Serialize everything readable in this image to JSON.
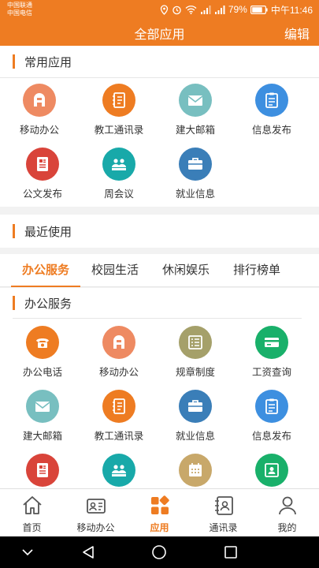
{
  "status_bar": {
    "carrier1": "中国联通",
    "carrier2": "中国电信",
    "battery": "79%",
    "time": "中午11:46"
  },
  "header": {
    "title": "全部应用",
    "edit": "编辑"
  },
  "common": {
    "title": "常用应用",
    "apps": [
      {
        "label": "移动办公",
        "icon": "a-logo-icon",
        "color": "#ee8a62"
      },
      {
        "label": "教工通讯录",
        "icon": "contacts-book-icon",
        "color": "#ee7c22"
      },
      {
        "label": "建大邮箱",
        "icon": "mail-icon",
        "color": "#78bfc0"
      },
      {
        "label": "信息发布",
        "icon": "clipboard-icon",
        "color": "#3d8fe0"
      },
      {
        "label": "公文发布",
        "icon": "document-icon",
        "color": "#d9443a"
      },
      {
        "label": "周会议",
        "icon": "meeting-icon",
        "color": "#18a9a9"
      },
      {
        "label": "就业信息",
        "icon": "briefcase-icon",
        "color": "#3a7eb8"
      }
    ]
  },
  "recent": {
    "title": "最近使用"
  },
  "tabs": [
    {
      "label": "办公服务",
      "active": true
    },
    {
      "label": "校园生活",
      "active": false
    },
    {
      "label": "休闲娱乐",
      "active": false
    },
    {
      "label": "排行榜单",
      "active": false
    }
  ],
  "office": {
    "title": "办公服务",
    "apps": [
      {
        "label": "办公电话",
        "icon": "phone-icon",
        "color": "#ee7c22"
      },
      {
        "label": "移动办公",
        "icon": "a-logo-icon",
        "color": "#ee8a62"
      },
      {
        "label": "规章制度",
        "icon": "list-doc-icon",
        "color": "#a5a06a"
      },
      {
        "label": "工资查询",
        "icon": "card-icon",
        "color": "#19b06a"
      },
      {
        "label": "建大邮箱",
        "icon": "mail-icon",
        "color": "#78bfc0"
      },
      {
        "label": "教工通讯录",
        "icon": "contacts-book-icon",
        "color": "#ee7c22"
      },
      {
        "label": "就业信息",
        "icon": "briefcase-icon",
        "color": "#3a7eb8"
      },
      {
        "label": "信息发布",
        "icon": "clipboard-icon",
        "color": "#3d8fe0"
      },
      {
        "label": "",
        "icon": "document-icon",
        "color": "#d9443a"
      },
      {
        "label": "",
        "icon": "meeting-icon",
        "color": "#18a9a9"
      },
      {
        "label": "",
        "icon": "calendar-icon",
        "color": "#c8a86a"
      },
      {
        "label": "",
        "icon": "id-card-icon",
        "color": "#19b06a"
      }
    ]
  },
  "bottom_nav": [
    {
      "label": "首页",
      "icon": "home-icon",
      "active": false
    },
    {
      "label": "移动办公",
      "icon": "office-card-icon",
      "active": false
    },
    {
      "label": "应用",
      "icon": "apps-grid-icon",
      "active": true
    },
    {
      "label": "通讯录",
      "icon": "address-book-icon",
      "active": false
    },
    {
      "label": "我的",
      "icon": "profile-icon",
      "active": false
    }
  ],
  "colors": {
    "accent": "#ee7c22",
    "text": "#333333"
  }
}
